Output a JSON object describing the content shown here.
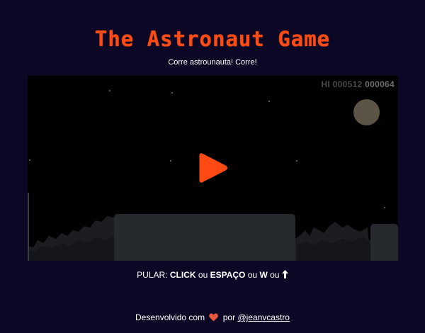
{
  "header": {
    "title": "The Astronaut Game",
    "subtitle": "Corre astrounauta! Corre!"
  },
  "game": {
    "hi_score": "HI 000512",
    "current_score": "000064",
    "play_icon": "play-icon",
    "colors": {
      "accent": "#ff4a14",
      "background": "#0b0724",
      "moon": "#5c5546",
      "platform": "#26292e"
    }
  },
  "controls": {
    "prefix": "PULAR:",
    "key_click": "CLICK",
    "sep1": "ou",
    "key_space": "ESPAÇO",
    "sep2": "ou",
    "key_w": "W",
    "sep3": "ou",
    "arrow_icon": "arrow-up-icon"
  },
  "footer": {
    "text_before": "Desenvolvido com",
    "heart_icon": "heart-icon",
    "text_by": "por",
    "author_link": "@jeanvcastro"
  }
}
